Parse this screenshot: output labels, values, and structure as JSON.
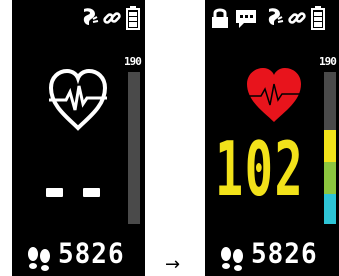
{
  "before": {
    "status_icons": [
      "phone-icon",
      "link-icon",
      "battery-icon"
    ],
    "hr_scale_max": "190",
    "hr_value": "- -",
    "steps": "5826",
    "colors": {
      "screen_bg": "#000000",
      "foreground": "#ffffff",
      "bar_bg": "#4a4a4a"
    }
  },
  "transition": {
    "arrow": "→"
  },
  "after": {
    "status_icons": [
      "lock-icon",
      "message-icon",
      "phone-icon",
      "link-icon",
      "battery-icon"
    ],
    "hr_scale_max": "190",
    "hr_value": "102",
    "steps": "5826",
    "colors": {
      "heart": "#e8141c",
      "hr_value": "#f2e21a",
      "zone_yellow": "#f2e21a",
      "zone_green": "#8dc63f",
      "zone_cyan": "#2ec4d6"
    }
  }
}
